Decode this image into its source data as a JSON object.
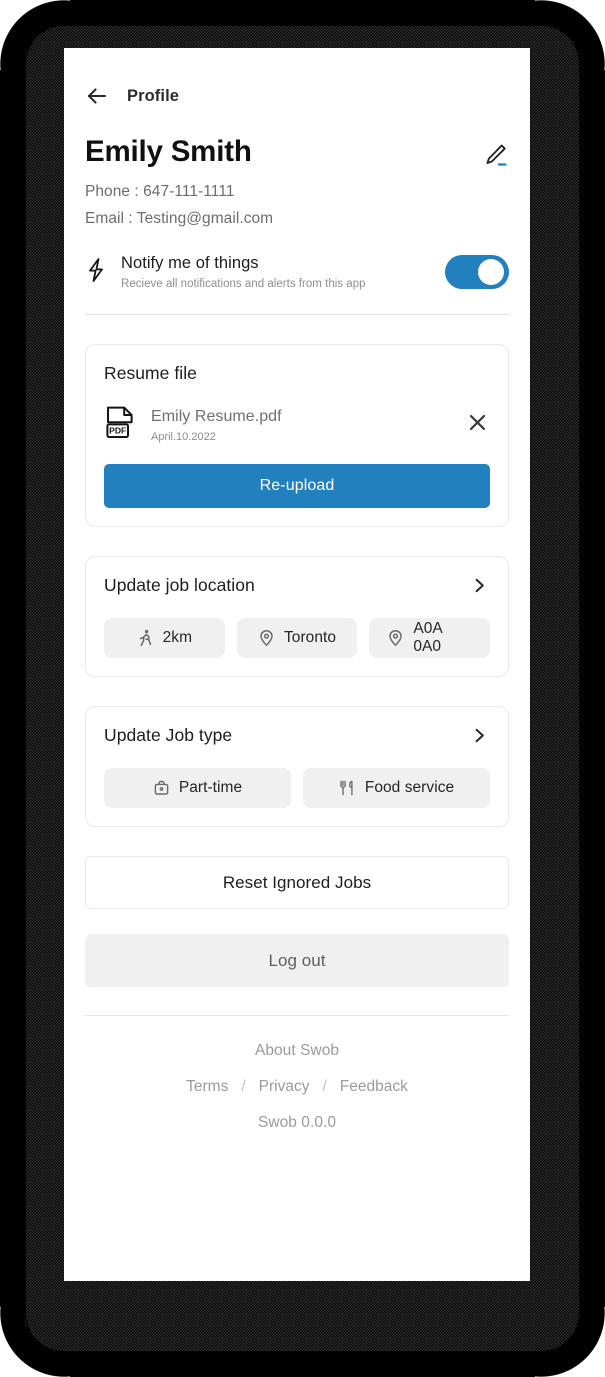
{
  "theme": {
    "accent": "#2180bd",
    "text_primary": "#1d1d1d",
    "text_muted": "#8d8d8d",
    "chip_bg": "#f0f0f0",
    "card_border": "#e9e9ef",
    "frame": "#000000"
  },
  "topbar": {
    "back_icon": "arrow-left-icon",
    "title": "Profile"
  },
  "identity": {
    "name": "Emily Smith",
    "edit_icon": "pencil-edit-icon",
    "phone": "Phone : 647-111-1111",
    "email": "Email : Testing@gmail.com"
  },
  "notify": {
    "icon": "lightning-bolt-icon",
    "title": "Notify me of things",
    "subtitle": "Recieve all notifications and alerts from this app",
    "toggle_on": true
  },
  "resume": {
    "title": "Resume file",
    "file_icon": "pdf-file-icon",
    "file_name": "Emily Resume.pdf",
    "file_date": "April.10.2022",
    "remove_icon": "close-x-icon",
    "upload_label": "Re-upload"
  },
  "location": {
    "title": "Update job location",
    "chevron_icon": "chevron-right-icon",
    "chips": [
      {
        "icon": "walking-person-icon",
        "label": "2km"
      },
      {
        "icon": "map-pin-icon",
        "label": "Toronto"
      },
      {
        "icon": "map-pin-icon",
        "label": "A0A 0A0"
      }
    ]
  },
  "jobtype": {
    "title": "Update Job type",
    "chevron_icon": "chevron-right-icon",
    "chips": [
      {
        "icon": "briefcase-icon",
        "label": "Part-time"
      },
      {
        "icon": "fork-knife-icon",
        "label": "Food service"
      }
    ]
  },
  "actions": {
    "reset_label": "Reset Ignored Jobs",
    "logout_label": "Log out"
  },
  "footer": {
    "about": "About Swob",
    "links": [
      {
        "label": "Terms"
      },
      {
        "label": "Privacy"
      },
      {
        "label": "Feedback"
      }
    ],
    "separator": "/",
    "version": "Swob 0.0.0"
  }
}
